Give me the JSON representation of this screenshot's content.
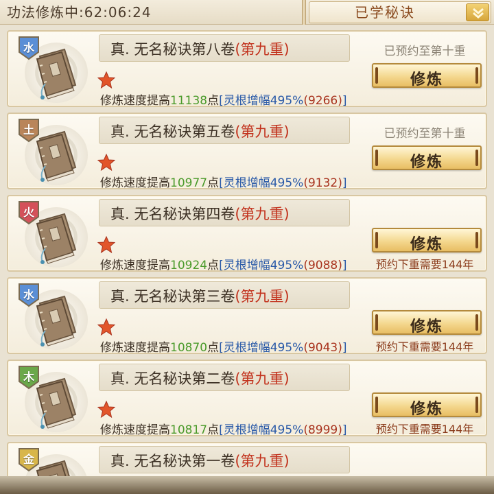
{
  "status_text": "功法修炼中:62:06:24",
  "dropdown": {
    "label": "已学秘诀"
  },
  "star_color": "#e2552a",
  "cards": [
    {
      "element": "水",
      "element_color": "#5b8fd6",
      "title": "真. 无名秘诀第八卷",
      "level": "(第九重)",
      "speed_prefix": "修炼速度提高",
      "speed": "11138",
      "speed_suffix": "点",
      "bonus": "[灵根增幅495%",
      "bonus_value": "(9266)",
      "bonus_close": "]",
      "reserve": "已预约至第十重",
      "button": "修炼",
      "req": ""
    },
    {
      "element": "土",
      "element_color": "#b9855a",
      "title": "真. 无名秘诀第五卷",
      "level": "(第九重)",
      "speed_prefix": "修炼速度提高",
      "speed": "10977",
      "speed_suffix": "点",
      "bonus": "[灵根增幅495%",
      "bonus_value": "(9132)",
      "bonus_close": "]",
      "reserve": "已预约至第十重",
      "button": "修炼",
      "req": ""
    },
    {
      "element": "火",
      "element_color": "#d4515a",
      "title": "真. 无名秘诀第四卷",
      "level": "(第九重)",
      "speed_prefix": "修炼速度提高",
      "speed": "10924",
      "speed_suffix": "点",
      "bonus": "[灵根增幅495%",
      "bonus_value": "(9088)",
      "bonus_close": "]",
      "reserve": "",
      "button": "修炼",
      "req": "预约下重需要144年"
    },
    {
      "element": "水",
      "element_color": "#5b8fd6",
      "title": "真. 无名秘诀第三卷",
      "level": "(第九重)",
      "speed_prefix": "修炼速度提高",
      "speed": "10870",
      "speed_suffix": "点",
      "bonus": "[灵根增幅495%",
      "bonus_value": "(9043)",
      "bonus_close": "]",
      "reserve": "",
      "button": "修炼",
      "req": "预约下重需要144年"
    },
    {
      "element": "木",
      "element_color": "#6aa84a",
      "title": "真. 无名秘诀第二卷",
      "level": "(第九重)",
      "speed_prefix": "修炼速度提高",
      "speed": "10817",
      "speed_suffix": "点",
      "bonus": "[灵根增幅495%",
      "bonus_value": "(8999)",
      "bonus_close": "]",
      "reserve": "",
      "button": "修炼",
      "req": "预约下重需要144年"
    },
    {
      "element": "金",
      "element_color": "#d8b64a",
      "title": "真. 无名秘诀第一卷",
      "level": "(第九重)",
      "speed_prefix": "",
      "speed": "",
      "speed_suffix": "",
      "bonus": "",
      "bonus_value": "",
      "bonus_close": "",
      "reserve": "",
      "button": "",
      "req": ""
    }
  ]
}
